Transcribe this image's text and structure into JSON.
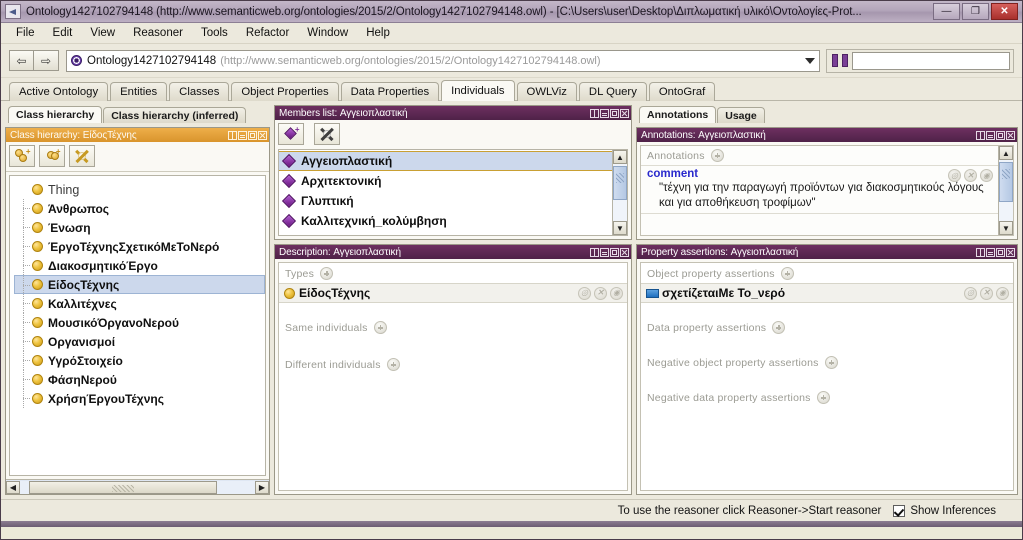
{
  "window": {
    "title": "Ontology1427102794148 (http://www.semanticweb.org/ontologies/2015/2/Ontology1427102794148.owl) - [C:\\Users\\user\\Desktop\\Διπλωματική υλικό\\Οντολογίες-Prot...",
    "minimize_label": "—",
    "maximize_label": "❐",
    "close_label": "✕",
    "app_icon": "protege-icon"
  },
  "menubar": {
    "items": [
      {
        "label": "File"
      },
      {
        "label": "Edit"
      },
      {
        "label": "View"
      },
      {
        "label": "Reasoner"
      },
      {
        "label": "Tools"
      },
      {
        "label": "Refactor"
      },
      {
        "label": "Window"
      },
      {
        "label": "Help"
      }
    ]
  },
  "ontology_bar": {
    "back_label": "⇦",
    "forward_label": "⇨",
    "ontology_name": "Ontology1427102794148",
    "ontology_iri": "(http://www.semanticweb.org/ontologies/2015/2/Ontology1427102794148.owl)",
    "dropdown_icon": "chevron-down-icon",
    "search_icon": "binoculars-icon",
    "search_value": "",
    "search_placeholder": ""
  },
  "main_tabs": {
    "items": [
      {
        "label": "Active Ontology",
        "active": false
      },
      {
        "label": "Entities",
        "active": false
      },
      {
        "label": "Classes",
        "active": false
      },
      {
        "label": "Object Properties",
        "active": false
      },
      {
        "label": "Data Properties",
        "active": false
      },
      {
        "label": "Individuals",
        "active": true
      },
      {
        "label": "OWLViz",
        "active": false
      },
      {
        "label": "DL Query",
        "active": false
      },
      {
        "label": "OntoGraf",
        "active": false
      }
    ]
  },
  "class_hierarchy": {
    "view_tabs": [
      {
        "label": "Class hierarchy",
        "active": true
      },
      {
        "label": "Class hierarchy (inferred)",
        "active": false
      }
    ],
    "panel_title": "Class hierarchy: ΕίδοςΤέχνης",
    "toolbar": [
      {
        "name": "add-subclass-button",
        "icon": "add-class-icon"
      },
      {
        "name": "add-sibling-class-button",
        "icon": "add-sibling-class-icon"
      },
      {
        "name": "delete-class-button",
        "icon": "delete-class-icon"
      }
    ],
    "tree": [
      {
        "label": "Thing",
        "depth": 0,
        "selected": false,
        "bold": false
      },
      {
        "label": "Άνθρωπος",
        "depth": 1,
        "selected": false,
        "bold": true
      },
      {
        "label": "Ένωση",
        "depth": 1,
        "selected": false,
        "bold": true
      },
      {
        "label": "ΈργοΤέχνηςΣχετικόΜεΤοΝερό",
        "depth": 1,
        "selected": false,
        "bold": true
      },
      {
        "label": "ΔιακοσμητικόΈργο",
        "depth": 1,
        "selected": false,
        "bold": true
      },
      {
        "label": "ΕίδοςΤέχνης",
        "depth": 1,
        "selected": true,
        "bold": true
      },
      {
        "label": "Καλλιτέχνες",
        "depth": 1,
        "selected": false,
        "bold": true
      },
      {
        "label": "ΜουσικόΌργανοΝερού",
        "depth": 1,
        "selected": false,
        "bold": true
      },
      {
        "label": "Οργανισμοί",
        "depth": 1,
        "selected": false,
        "bold": true
      },
      {
        "label": "ΥγρόΣτοιχείο",
        "depth": 1,
        "selected": false,
        "bold": true
      },
      {
        "label": "ΦάσηΝερού",
        "depth": 1,
        "selected": false,
        "bold": true
      },
      {
        "label": "ΧρήσηΈργουΤέχνης",
        "depth": 1,
        "selected": false,
        "bold": true
      }
    ],
    "hscroll": {
      "left_arrow": "◀",
      "right_arrow": "▶"
    }
  },
  "members_list": {
    "panel_title": "Members list: Αγγειοπλαστική",
    "toolbar": [
      {
        "name": "add-individual-button",
        "icon": "add-individual-icon"
      },
      {
        "name": "delete-individual-button",
        "icon": "delete-individual-icon"
      }
    ],
    "items": [
      {
        "label": "Αγγειοπλαστική",
        "selected": true
      },
      {
        "label": "Αρχιτεκτονική",
        "selected": false
      },
      {
        "label": "Γλυπτική",
        "selected": false
      },
      {
        "label": "Καλλιτεχνική_κολύμβηση",
        "selected": false
      }
    ],
    "scroll": {
      "up_arrow": "▲",
      "down_arrow": "▼"
    }
  },
  "description": {
    "panel_title": "Description: Αγγειοπλαστική",
    "sections": [
      {
        "label": "Types",
        "values": [
          {
            "label": "ΕίδοςΤέχνης",
            "icon": "class-icon"
          }
        ]
      },
      {
        "label": "Same individuals",
        "values": []
      },
      {
        "label": "Different individuals",
        "values": []
      }
    ]
  },
  "annotations": {
    "view_tabs": [
      {
        "label": "Annotations",
        "active": true
      },
      {
        "label": "Usage",
        "active": false
      }
    ],
    "panel_title": "Annotations: Αγγειοπλαστική",
    "section_label": "Annotations",
    "entries": [
      {
        "key": "comment",
        "value": "\"τέχνη για την παραγωγή προϊόντων για διακοσμητικούς λόγους και για αποθήκευση τροφίμων\""
      }
    ],
    "scroll": {
      "up_arrow": "▲",
      "down_arrow": "▼"
    }
  },
  "property_assertions": {
    "panel_title": "Property assertions: Αγγειοπλαστική",
    "sections": [
      {
        "label": "Object property assertions",
        "values": [
          {
            "label": "σχετίζεταιΜε  Το_νερό",
            "icon": "object-property-icon"
          }
        ]
      },
      {
        "label": "Data property assertions",
        "values": []
      },
      {
        "label": "Negative object property assertions",
        "values": []
      },
      {
        "label": "Negative data property assertions",
        "values": []
      }
    ]
  },
  "row_actions": {
    "edit_label": "◎",
    "delete_label": "✕",
    "extra_label": "◉"
  },
  "panel_header_buttons": [
    {
      "name": "split-view-button",
      "icon": "split-view-icon"
    },
    {
      "name": "collapse-view-button",
      "icon": "collapse-view-icon"
    },
    {
      "name": "maximize-view-button",
      "icon": "maximize-view-icon"
    },
    {
      "name": "close-view-button",
      "icon": "close-view-icon"
    }
  ],
  "statusbar": {
    "reasoner_hint": "To use the reasoner click Reasoner->Start reasoner",
    "show_inferences_label": "Show Inferences",
    "show_inferences_checked": true
  },
  "colors": {
    "panel_header_purple": "#5E2A52",
    "panel_header_gold": "#D9942C",
    "titlebar_purple": "#B3A5BA",
    "app_background": "#ECE9DD",
    "selection_blue": "#CCD8EC",
    "class_icon_gold": "#EEC33F",
    "individual_icon_purple": "#7B2C96",
    "object_property_blue": "#1F6FBF",
    "annotation_key_blue": "#2A2ACD"
  }
}
